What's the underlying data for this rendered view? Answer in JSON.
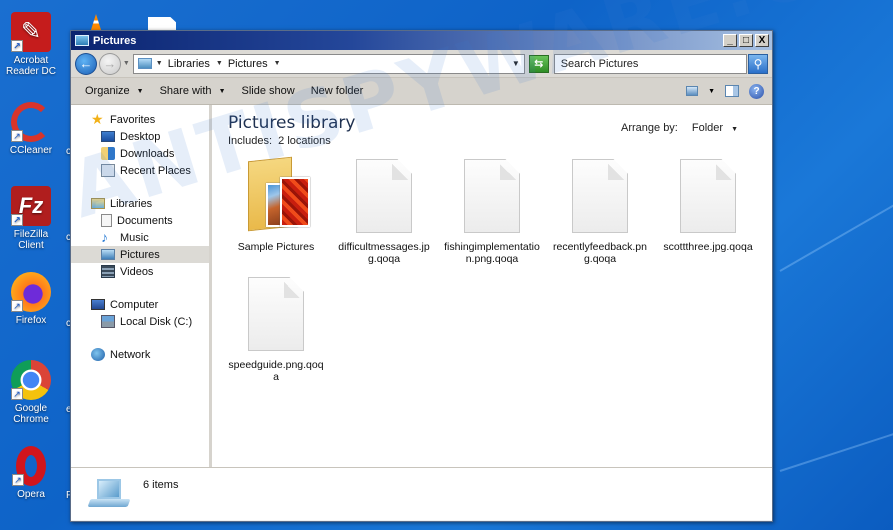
{
  "desktop": {
    "icons": [
      {
        "name": "acrobat",
        "label": "Acrobat Reader DC",
        "color": "#c51c1c"
      },
      {
        "name": "ccleaner",
        "label": "CCleaner",
        "color": "#d8342a"
      },
      {
        "name": "filezilla",
        "label": "FileZilla Client",
        "color": "#b01e1e"
      },
      {
        "name": "firefox",
        "label": "Firefox",
        "color": "#ff7a1a"
      },
      {
        "name": "chrome",
        "label": "Google Chrome",
        "color": "#4285f4"
      },
      {
        "name": "opera",
        "label": "Opera",
        "color": "#d0151c"
      }
    ],
    "clipped_labels": [
      "c",
      "c",
      "c",
      "e",
      "F"
    ]
  },
  "window": {
    "title": "Pictures",
    "controls": {
      "minimize": "_",
      "maximize": "□",
      "close": "X"
    },
    "address": {
      "crumbs": [
        "Libraries",
        "Pictures"
      ]
    },
    "search": {
      "placeholder": "Search Pictures"
    },
    "toolbar": {
      "organize": "Organize",
      "share_with": "Share with",
      "slide_show": "Slide show",
      "new_folder": "New folder",
      "help": "?"
    },
    "nav_pane": {
      "favorites": {
        "label": "Favorites",
        "items": [
          "Desktop",
          "Downloads",
          "Recent Places"
        ]
      },
      "libraries": {
        "label": "Libraries",
        "items": [
          "Documents",
          "Music",
          "Pictures",
          "Videos"
        ],
        "selected": "Pictures"
      },
      "computer": {
        "label": "Computer",
        "items": [
          "Local Disk (C:)"
        ]
      },
      "network": {
        "label": "Network"
      }
    },
    "content": {
      "title": "Pictures library",
      "includes_label": "Includes:",
      "includes_value": "2 locations",
      "arrange_by_label": "Arrange by:",
      "arrange_by_value": "Folder",
      "files": [
        {
          "name": "Sample Pictures",
          "type": "folder"
        },
        {
          "name": "difficultmessages.jpg.qoqa",
          "type": "file"
        },
        {
          "name": "fishingimplementation.png.qoqa",
          "type": "file"
        },
        {
          "name": "recentlyfeedback.png.qoqa",
          "type": "file"
        },
        {
          "name": "scottthree.jpg.qoqa",
          "type": "file"
        },
        {
          "name": "speedguide.png.qoqa",
          "type": "file"
        }
      ]
    },
    "details": {
      "count": "6 items"
    }
  },
  "watermark": "ANTISPYWARE.C"
}
